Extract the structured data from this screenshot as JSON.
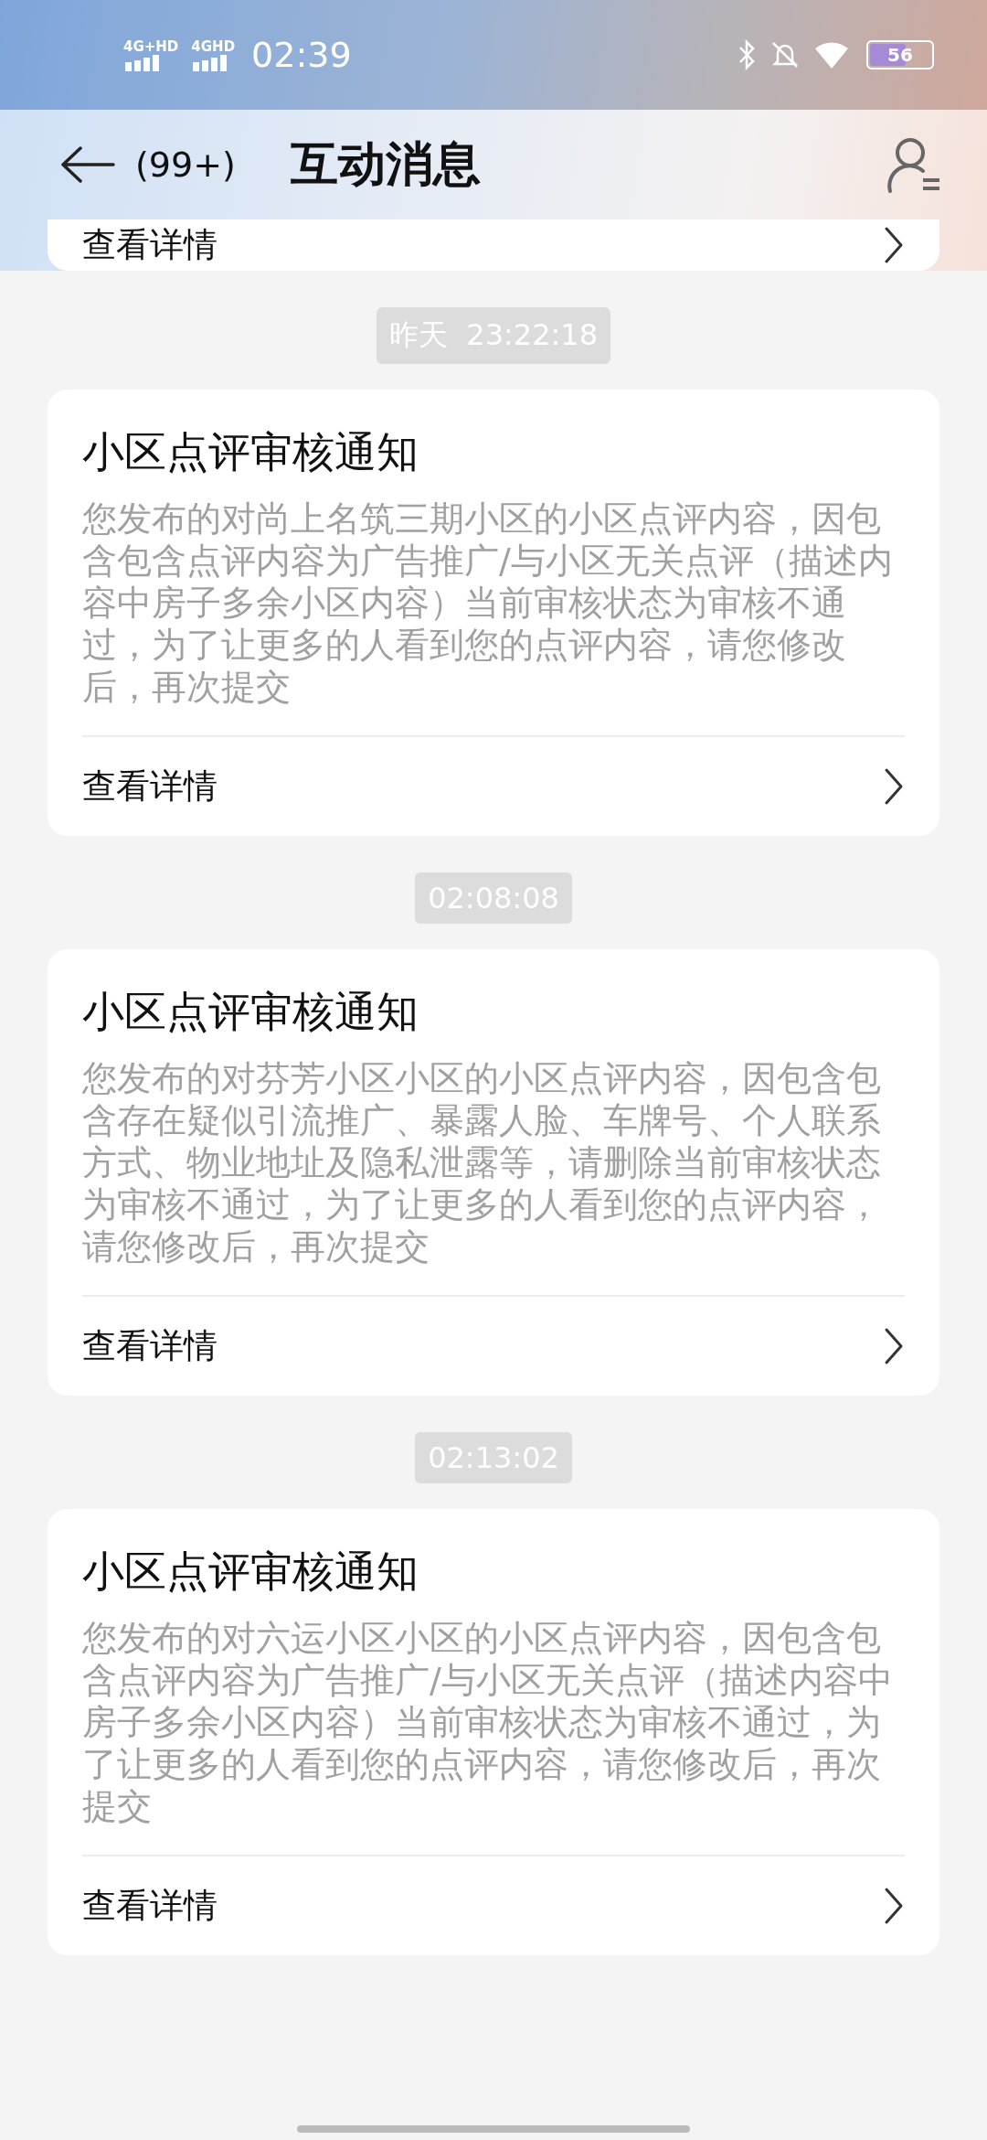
{
  "status_bar": {
    "signals": [
      "4G+HD",
      "4GHD"
    ],
    "time": "02:39",
    "battery": "56"
  },
  "header": {
    "count": "(99+)",
    "title": "互动消息"
  },
  "partial_card": {
    "link": "查看详情"
  },
  "messages": [
    {
      "timestamp": "昨天  23:22:18",
      "title": "小区点评审核通知",
      "body": "您发布的对尚上名筑三期小区的小区点评内容，因包含包含点评内容为广告推广/与小区无关点评（描述内容中房子多余小区内容）当前审核状态为审核不通过，为了让更多的人看到您的点评内容，请您修改后，再次提交",
      "link": "查看详情"
    },
    {
      "timestamp": "02:08:08",
      "title": "小区点评审核通知",
      "body": "您发布的对芬芳小区小区的小区点评内容，因包含包含存在疑似引流推广、暴露人脸、车牌号、个人联系方式、物业地址及隐私泄露等，请删除当前审核状态为审核不通过，为了让更多的人看到您的点评内容，请您修改后，再次提交",
      "link": "查看详情"
    },
    {
      "timestamp": "02:13:02",
      "title": "小区点评审核通知",
      "body": "您发布的对六运小区小区的小区点评内容，因包含包含点评内容为广告推广/与小区无关点评（描述内容中房子多余小区内容）当前审核状态为审核不通过，为了让更多的人看到您的点评内容，请您修改后，再次提交",
      "link": "查看详情"
    }
  ]
}
